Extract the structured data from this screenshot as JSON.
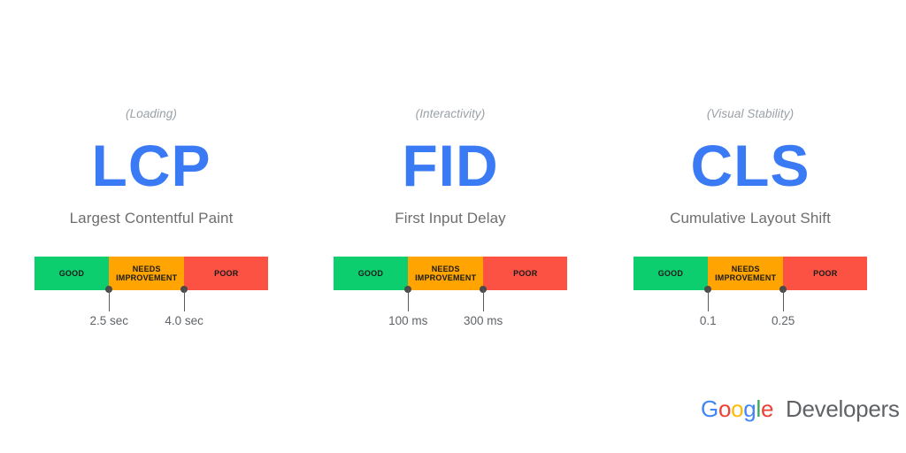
{
  "page": {
    "background": "#ffffff",
    "accent_blue": "#3b7af5",
    "label_gray": "#6e6e6e",
    "muted_gray": "#9aa0a6"
  },
  "colors": {
    "good": "#0dce6e",
    "needs_improvement": "#ffa400",
    "poor": "#fb5244",
    "tick": "#4b4b4b"
  },
  "metrics": [
    {
      "category": "(Loading)",
      "acronym": "LCP",
      "fullname": "Largest Contentful Paint",
      "segments": [
        {
          "label": "GOOD",
          "color": "#0dce6e",
          "width_pct": 32
        },
        {
          "label": "NEEDS IMPROVEMENT",
          "color": "#ffa400",
          "width_pct": 32
        },
        {
          "label": "POOR",
          "color": "#fb5244",
          "width_pct": 36
        }
      ],
      "thresholds": [
        {
          "value": "2.5 sec",
          "position_pct": 32
        },
        {
          "value": "4.0 sec",
          "position_pct": 64
        }
      ]
    },
    {
      "category": "(Interactivity)",
      "acronym": "FID",
      "fullname": "First Input Delay",
      "segments": [
        {
          "label": "GOOD",
          "color": "#0dce6e",
          "width_pct": 32
        },
        {
          "label": "NEEDS IMPROVEMENT",
          "color": "#ffa400",
          "width_pct": 32
        },
        {
          "label": "POOR",
          "color": "#fb5244",
          "width_pct": 36
        }
      ],
      "thresholds": [
        {
          "value": "100 ms",
          "position_pct": 32
        },
        {
          "value": "300 ms",
          "position_pct": 64
        }
      ]
    },
    {
      "category": "(Visual Stability)",
      "acronym": "CLS",
      "fullname": "Cumulative Layout Shift",
      "segments": [
        {
          "label": "GOOD",
          "color": "#0dce6e",
          "width_pct": 32
        },
        {
          "label": "NEEDS IMPROVEMENT",
          "color": "#ffa400",
          "width_pct": 32
        },
        {
          "label": "POOR",
          "color": "#fb5244",
          "width_pct": 36
        }
      ],
      "thresholds": [
        {
          "value": "0.1",
          "position_pct": 32
        },
        {
          "value": "0.25",
          "position_pct": 64
        }
      ]
    }
  ],
  "logo": {
    "google_letters": [
      {
        "char": "G",
        "color": "#4285f4"
      },
      {
        "char": "o",
        "color": "#ea4335"
      },
      {
        "char": "o",
        "color": "#fbbc05"
      },
      {
        "char": "g",
        "color": "#4285f4"
      },
      {
        "char": "l",
        "color": "#34a853"
      },
      {
        "char": "e",
        "color": "#ea4335"
      }
    ],
    "google_text": "Google",
    "developers_text": "Developers"
  }
}
